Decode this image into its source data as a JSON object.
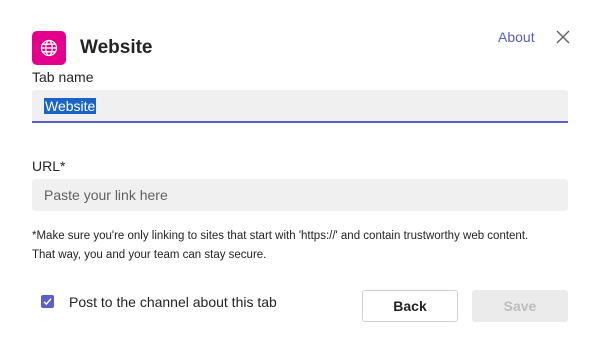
{
  "header": {
    "title": "Website",
    "about_label": "About",
    "app_icon": "globe-icon",
    "close_icon": "close-icon"
  },
  "tab_name": {
    "label": "Tab name",
    "value": "Website"
  },
  "url": {
    "label": "URL*",
    "placeholder": "Paste your link here"
  },
  "note": {
    "line1": "*Make sure you're only linking to sites that start with 'https://' and contain trustworthy web content.",
    "line2": "That way, you and your team can stay secure."
  },
  "post_option": {
    "label": "Post to the channel about this tab",
    "checked": true
  },
  "buttons": {
    "back": "Back",
    "save": "Save"
  },
  "colors": {
    "accent": "#5b5fc7",
    "app_icon_bg": "#e3008c"
  }
}
